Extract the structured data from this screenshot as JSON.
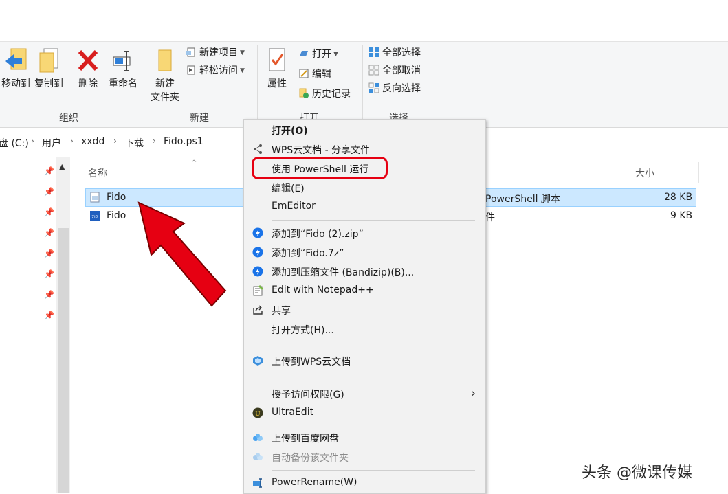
{
  "ribbon": {
    "organize": {
      "label": "组织",
      "move_to": "移动到",
      "copy_to": "复制到",
      "delete": "删除",
      "rename": "重命名"
    },
    "new": {
      "label": "新建",
      "new_folder_line1": "新建",
      "new_folder_line2": "文件夹",
      "new_item": "新建项目",
      "easy_access": "轻松访问"
    },
    "open": {
      "label": "打开",
      "properties": "属性",
      "open": "打开",
      "edit": "编辑",
      "history": "历史记录"
    },
    "select": {
      "label": "选择",
      "select_all": "全部选择",
      "select_none": "全部取消",
      "invert": "反向选择"
    }
  },
  "breadcrumb": [
    "盘 (C:)",
    "用户",
    "xxdd",
    "下载",
    "Fido.ps1"
  ],
  "columns": {
    "name": "名称",
    "size": "大小"
  },
  "files": [
    {
      "name": "Fido",
      "type": "PowerShell 脚本",
      "size": "28 KB",
      "icon": "powershell-script-icon",
      "selected": true
    },
    {
      "name": "Fido",
      "type": "件",
      "size": "9 KB",
      "icon": "zip-archive-icon",
      "selected": false
    }
  ],
  "context_menu": {
    "open": "打开(O)",
    "wps_share": "WPS云文档 - 分享文件",
    "run_powershell": "使用 PowerShell 运行",
    "edit": "编辑(E)",
    "emeditor": "EmEditor",
    "add_zip": "添加到“Fido (2).zip”",
    "add_7z": "添加到“Fido.7z”",
    "add_bandizip": "添加到压缩文件 (Bandizip)(B)...",
    "notepadpp": "Edit with Notepad++",
    "share": "共享",
    "open_with": "打开方式(H)...",
    "upload_wps": "上传到WPS云文档",
    "grant_access": "授予访问权限(G)",
    "ultraedit": "UltraEdit",
    "upload_baidu": "上传到百度网盘",
    "auto_backup": "自动备份该文件夹",
    "powerrename": "PowerRename(W)"
  },
  "watermark": "头条 @微课传媒",
  "colors": {
    "selection": "#cce8ff",
    "highlight_ring": "#e60012",
    "arrow": "#e60012",
    "bandizip_blue": "#1a73e8"
  }
}
